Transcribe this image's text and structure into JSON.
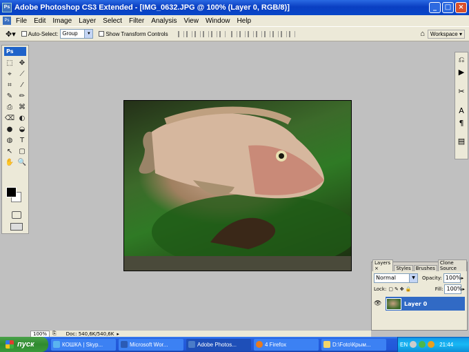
{
  "window": {
    "title": "Adobe Photoshop CS3 Extended - [IMG_0632.JPG @ 100% (Layer 0, RGB/8)]",
    "app_icon": "Ps",
    "controls": {
      "minimize": "_",
      "maximize": "□",
      "close": "×"
    }
  },
  "menubar": {
    "items": [
      "File",
      "Edit",
      "Image",
      "Layer",
      "Select",
      "Filter",
      "Analysis",
      "View",
      "Window",
      "Help"
    ]
  },
  "options_bar": {
    "auto_select_label": "Auto-Select:",
    "auto_select_value": "Group",
    "show_transform_label": "Show Transform Controls",
    "workspace_label": "Workspace ▾"
  },
  "toolbox": {
    "logo": "Ps",
    "tools": [
      "⬚",
      "✥",
      "⌖",
      "⟋",
      "⌗",
      "⁄",
      "✎",
      "✏",
      "⎙",
      "⌘",
      "⌫",
      "◐",
      "●",
      "◒",
      "◍",
      "T",
      "↖",
      "▢",
      "✋",
      "🔍"
    ]
  },
  "layers_panel": {
    "tabs": [
      "Layers ×",
      "Styles",
      "Brushes",
      "Clone Source"
    ],
    "blend_mode": "Normal",
    "opacity_label": "Opacity:",
    "opacity_value": "100%",
    "lock_label": "Lock:",
    "fill_label": "Fill:",
    "fill_value": "100%",
    "layer_name": "Layer 0"
  },
  "status_bar": {
    "zoom": "100%",
    "doc_info": "Doc: 540,6K/540,6K"
  },
  "taskbar": {
    "start_label": "пуск",
    "tasks": [
      {
        "label": "КОШКА | Skyp...",
        "active": false
      },
      {
        "label": "Microsoft Wor...",
        "active": false
      },
      {
        "label": "Adobe Photos...",
        "active": true
      },
      {
        "label": "4 Firefox",
        "active": false
      },
      {
        "label": "D:\\Foto\\Крым...",
        "active": false
      }
    ],
    "lang": "EN",
    "clock": "21:44"
  }
}
